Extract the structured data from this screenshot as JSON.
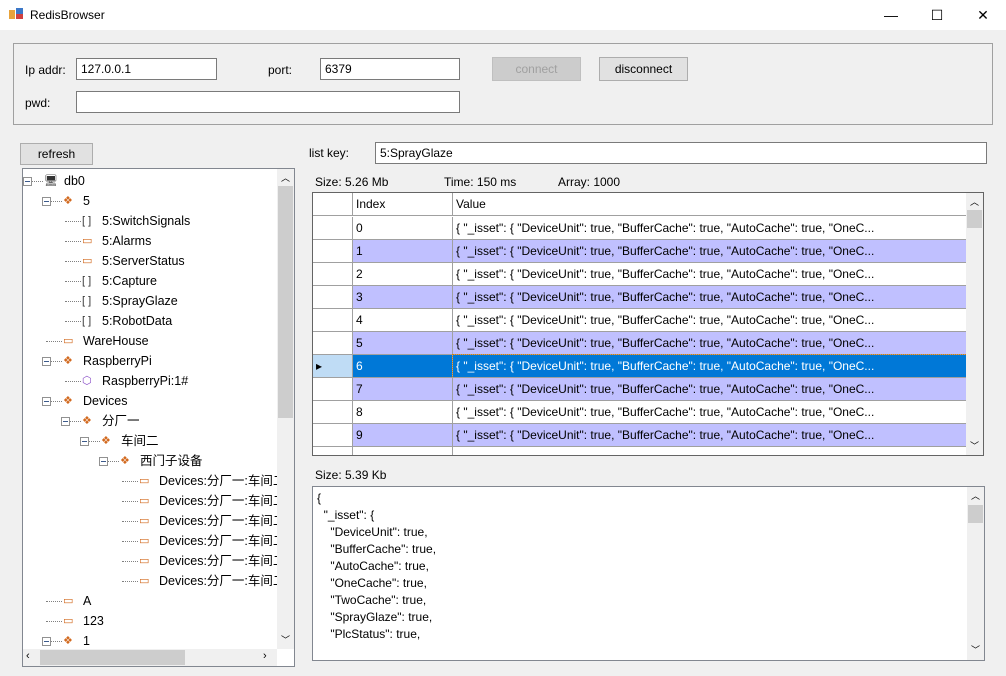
{
  "window": {
    "title": "RedisBrowser",
    "minimize": "—",
    "maximize": "☐",
    "close": "✕"
  },
  "connection": {
    "ip_label": "Ip addr:",
    "ip_value": "127.0.0.1",
    "port_label": "port:",
    "port_value": "6379",
    "pwd_label": "pwd:",
    "pwd_value": "",
    "connect_label": "connect",
    "disconnect_label": "disconnect"
  },
  "refresh_label": "refresh",
  "tree": [
    {
      "label": "db0",
      "level": 0,
      "type": "database",
      "expanded": true
    },
    {
      "label": "5",
      "level": 1,
      "type": "folder",
      "expanded": true
    },
    {
      "label": "5:SwitchSignals",
      "level": 2,
      "type": "list"
    },
    {
      "label": "5:Alarms",
      "level": 2,
      "type": "string"
    },
    {
      "label": "5:ServerStatus",
      "level": 2,
      "type": "string"
    },
    {
      "label": "5:Capture",
      "level": 2,
      "type": "list"
    },
    {
      "label": "5:SprayGlaze",
      "level": 2,
      "type": "list"
    },
    {
      "label": "5:RobotData",
      "level": 2,
      "type": "list"
    },
    {
      "label": "WareHouse",
      "level": 1,
      "type": "string"
    },
    {
      "label": "RaspberryPi",
      "level": 1,
      "type": "folder",
      "expanded": true
    },
    {
      "label": "RaspberryPi:1#",
      "level": 2,
      "type": "hash"
    },
    {
      "label": "Devices",
      "level": 1,
      "type": "folder",
      "expanded": true
    },
    {
      "label": "分厂一",
      "level": 2,
      "type": "folder",
      "expanded": true
    },
    {
      "label": "车间二",
      "level": 3,
      "type": "folder",
      "expanded": true
    },
    {
      "label": "西门子设备",
      "level": 4,
      "type": "folder",
      "expanded": true
    },
    {
      "label": "Devices:分厂一:车间二",
      "level": 5,
      "type": "string"
    },
    {
      "label": "Devices:分厂一:车间二",
      "level": 5,
      "type": "string"
    },
    {
      "label": "Devices:分厂一:车间二",
      "level": 5,
      "type": "string"
    },
    {
      "label": "Devices:分厂一:车间二",
      "level": 5,
      "type": "string"
    },
    {
      "label": "Devices:分厂一:车间二",
      "level": 5,
      "type": "string"
    },
    {
      "label": "Devices:分厂一:车间二",
      "level": 5,
      "type": "string"
    },
    {
      "label": "A",
      "level": 1,
      "type": "string"
    },
    {
      "label": "123",
      "level": 1,
      "type": "string"
    },
    {
      "label": "1",
      "level": 1,
      "type": "folder",
      "expanded": true
    }
  ],
  "list_key": {
    "label": "list key:",
    "value": "5:SprayGlaze"
  },
  "stats": {
    "size": "Size: 5.26 Mb",
    "time": "Time: 150 ms",
    "array": "Array: 1000"
  },
  "grid": {
    "columns": [
      "Index",
      "Value"
    ],
    "selected_index": 6,
    "rows": [
      {
        "index": "0",
        "value": "{  \"_isset\": {     \"DeviceUnit\": true,     \"BufferCache\": true,     \"AutoCache\": true,     \"OneC..."
      },
      {
        "index": "1",
        "value": "{  \"_isset\": {     \"DeviceUnit\": true,     \"BufferCache\": true,     \"AutoCache\": true,     \"OneC..."
      },
      {
        "index": "2",
        "value": "{  \"_isset\": {     \"DeviceUnit\": true,     \"BufferCache\": true,     \"AutoCache\": true,     \"OneC..."
      },
      {
        "index": "3",
        "value": "{  \"_isset\": {     \"DeviceUnit\": true,     \"BufferCache\": true,     \"AutoCache\": true,     \"OneC..."
      },
      {
        "index": "4",
        "value": "{  \"_isset\": {     \"DeviceUnit\": true,     \"BufferCache\": true,     \"AutoCache\": true,     \"OneC..."
      },
      {
        "index": "5",
        "value": "{  \"_isset\": {     \"DeviceUnit\": true,     \"BufferCache\": true,     \"AutoCache\": true,     \"OneC..."
      },
      {
        "index": "6",
        "value": "{  \"_isset\": {     \"DeviceUnit\": true,     \"BufferCache\": true,     \"AutoCache\": true,     \"OneC..."
      },
      {
        "index": "7",
        "value": "{  \"_isset\": {     \"DeviceUnit\": true,     \"BufferCache\": true,     \"AutoCache\": true,     \"OneC..."
      },
      {
        "index": "8",
        "value": "{  \"_isset\": {     \"DeviceUnit\": true,     \"BufferCache\": true,     \"AutoCache\": true,     \"OneC..."
      },
      {
        "index": "9",
        "value": "{  \"_isset\": {     \"DeviceUnit\": true,     \"BufferCache\": true,     \"AutoCache\": true,     \"OneC..."
      }
    ],
    "colors": {
      "alt_row": "#c0c0ff",
      "selected": "#0078d7",
      "row_header_selected": "#bfdcf5"
    }
  },
  "detail": {
    "size": "Size: 5.39 Kb",
    "lines": [
      "{",
      "  \"_isset\": {",
      "    \"DeviceUnit\": true,",
      "    \"BufferCache\": true,",
      "    \"AutoCache\": true,",
      "    \"OneCache\": true,",
      "    \"TwoCache\": true,",
      "    \"SprayGlaze\": true,",
      "    \"PlcStatus\": true,"
    ]
  }
}
